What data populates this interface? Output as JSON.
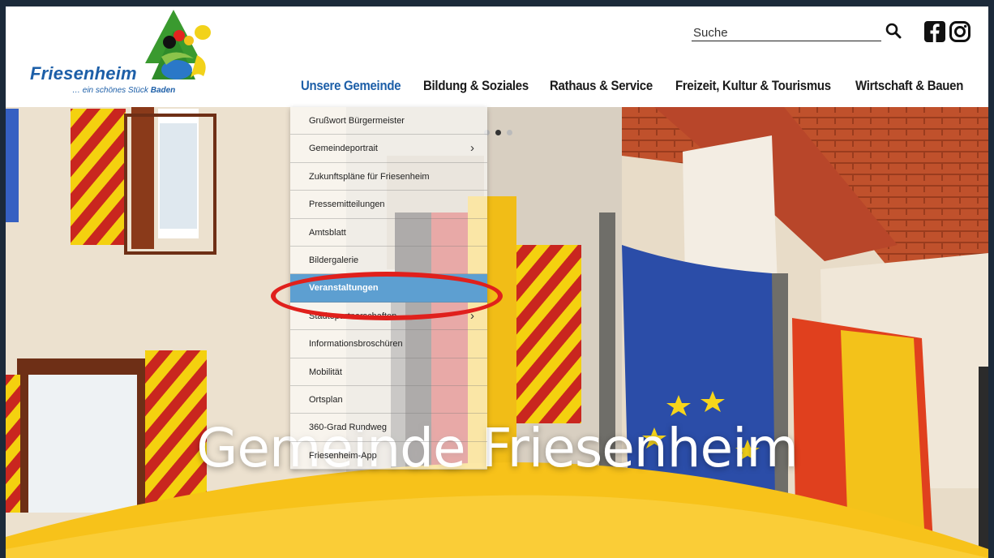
{
  "logo": {
    "wordmark": "Friesenheim",
    "tagline_prefix": "… ein schönes Stück",
    "tagline_bold": "Baden"
  },
  "search": {
    "placeholder": "Suche",
    "icon": "search-icon"
  },
  "social": [
    {
      "name": "facebook-icon"
    },
    {
      "name": "instagram-icon"
    }
  ],
  "nav": {
    "items": [
      {
        "label": "Unsere Gemeinde",
        "active": true
      },
      {
        "label": "Bildung & Soziales"
      },
      {
        "label": "Rathaus & Service"
      },
      {
        "label": "Freizeit, Kultur & Tourismus"
      },
      {
        "label": "Wirtschaft & Bauen"
      }
    ]
  },
  "dropdown": {
    "items": [
      {
        "label": "Grußwort Bürgermeister"
      },
      {
        "label": "Gemeindeportrait",
        "has_submenu": true
      },
      {
        "label": "Zukunftspläne für Friesenheim"
      },
      {
        "label": "Pressemitteilungen"
      },
      {
        "label": "Amtsblatt"
      },
      {
        "label": "Bildergalerie"
      },
      {
        "label": "Veranstaltungen",
        "selected": true
      },
      {
        "label": "Städtepartnerschaften",
        "has_submenu": true
      },
      {
        "label": "Informationsbroschüren"
      },
      {
        "label": "Mobilität"
      },
      {
        "label": "Ortsplan"
      },
      {
        "label": "360-Grad Rundweg"
      },
      {
        "label": "Friesenheim-App"
      }
    ],
    "submenu_glyph": "›"
  },
  "hero": {
    "title": "Gemeinde Friesenheim",
    "slides": 3,
    "active_slide": 2
  },
  "colors": {
    "brand_blue": "#1d5fa8",
    "selected_bg": "#5d9fd1",
    "highlight_red": "#e0201c",
    "wave_yellow": "#f7c21a"
  }
}
